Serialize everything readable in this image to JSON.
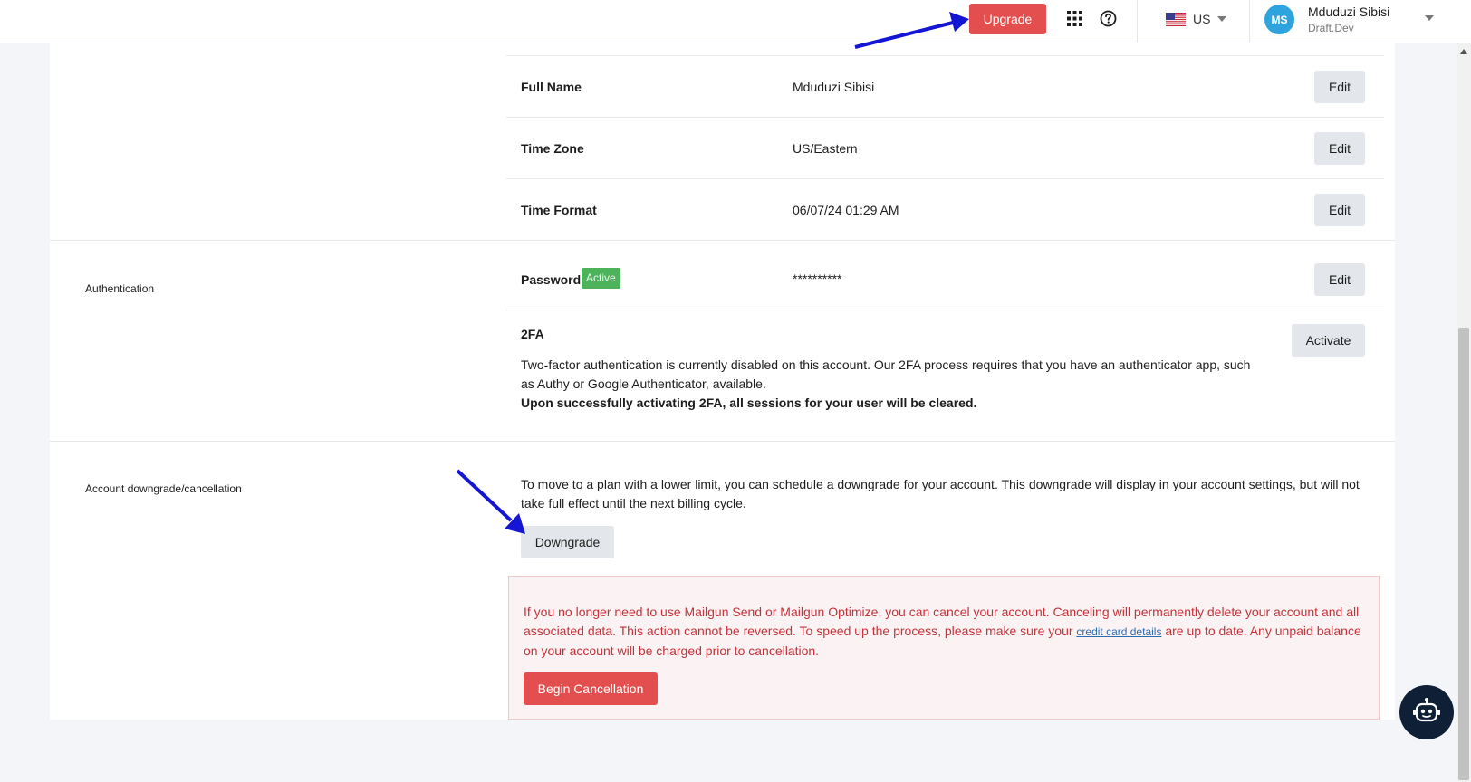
{
  "header": {
    "upgrade_label": "Upgrade",
    "region_label": "US",
    "user_initials": "MS",
    "user_name": "Mduduzi Sibisi",
    "user_org": "Draft.Dev"
  },
  "profile": {
    "rows": [
      {
        "label": "Full Name",
        "value": "Mduduzi Sibisi",
        "action": "Edit"
      },
      {
        "label": "Time Zone",
        "value": "US/Eastern",
        "action": "Edit"
      },
      {
        "label": "Time Format",
        "value": "06/07/24 01:29 AM",
        "action": "Edit"
      }
    ]
  },
  "authentication": {
    "section_label": "Authentication",
    "password_label": "Password",
    "password_badge": "Active",
    "password_value": "**********",
    "password_action": "Edit",
    "twofa_label": "2FA",
    "twofa_text": "Two-factor authentication is currently disabled on this account. Our 2FA process requires that you have an authenticator app, such as Authy or Google Authenticator, available.",
    "twofa_note": "Upon successfully activating 2FA, all sessions for your user will be cleared.",
    "twofa_action": "Activate"
  },
  "downgrade": {
    "section_label": "Account downgrade/cancellation",
    "text": "To move to a plan with a lower limit, you can schedule a downgrade for your account. This downgrade will display in your account settings, but will not take full effect until the next billing cycle.",
    "button_label": "Downgrade"
  },
  "cancellation": {
    "text_before": "If you no longer need to use Mailgun Send or Mailgun Optimize, you can cancel your account. Canceling will permanently delete your account and all associated data. This action cannot be reversed.  To speed up the process, please make sure your ",
    "link_text": "credit card details",
    "text_after": " are up to date. Any unpaid balance on your account will be charged prior to cancellation.",
    "button_label": "Begin Cancellation"
  },
  "colors": {
    "accent_red": "#e34f4f",
    "danger_text": "#c4323a",
    "badge_green": "#4db35a",
    "annotation_arrow": "#1515d4",
    "avatar_blue": "#2ea3dd"
  },
  "icons": [
    "apps-grid-icon",
    "help-circle-icon",
    "us-flag-icon",
    "chevron-down-icon",
    "chatbot-icon",
    "scroll-up-arrow-icon"
  ]
}
